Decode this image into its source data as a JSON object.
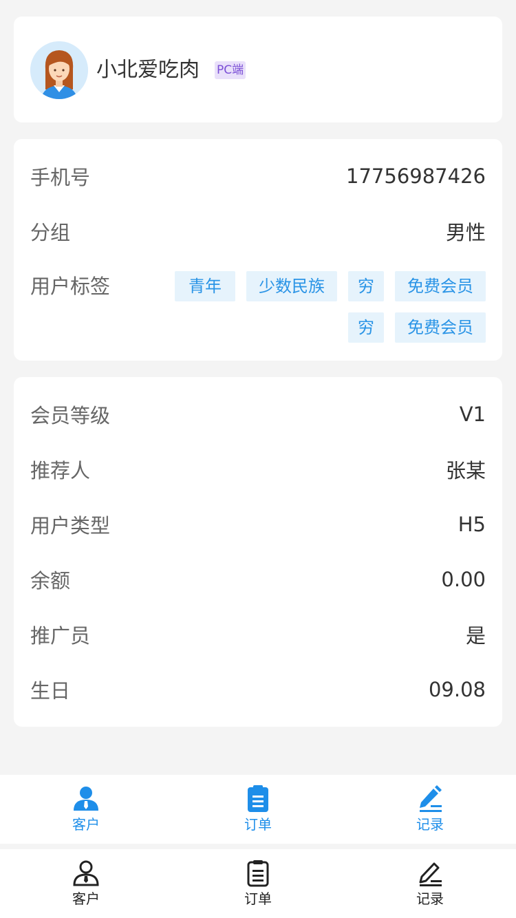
{
  "profile": {
    "name": "小北爱吃肉",
    "badge": "PC端"
  },
  "basic": {
    "rows": [
      {
        "label": "手机号",
        "value": "17756987426"
      },
      {
        "label": "分组",
        "value": "男性"
      }
    ],
    "tags_label": "用户标签",
    "tags": [
      "青年",
      "少数民族",
      "穷",
      "免费会员",
      "穷",
      "免费会员"
    ]
  },
  "member": {
    "rows": [
      {
        "label": "会员等级",
        "value": "V1"
      },
      {
        "label": "推荐人",
        "value": "张某"
      },
      {
        "label": "用户类型",
        "value": "H5"
      },
      {
        "label": "余额",
        "value": "0.00"
      },
      {
        "label": "推广员",
        "value": "是"
      },
      {
        "label": "生日",
        "value": "09.08"
      }
    ]
  },
  "tabbar_active": {
    "color": "#1e8ee9",
    "items": [
      {
        "label": "客户",
        "icon": "customer-icon"
      },
      {
        "label": "订单",
        "icon": "order-icon"
      },
      {
        "label": "记录",
        "icon": "record-icon"
      }
    ]
  },
  "tabbar_default": {
    "color": "#222222",
    "items": [
      {
        "label": "客户",
        "icon": "customer-icon"
      },
      {
        "label": "订单",
        "icon": "order-icon"
      },
      {
        "label": "记录",
        "icon": "record-icon"
      }
    ]
  }
}
